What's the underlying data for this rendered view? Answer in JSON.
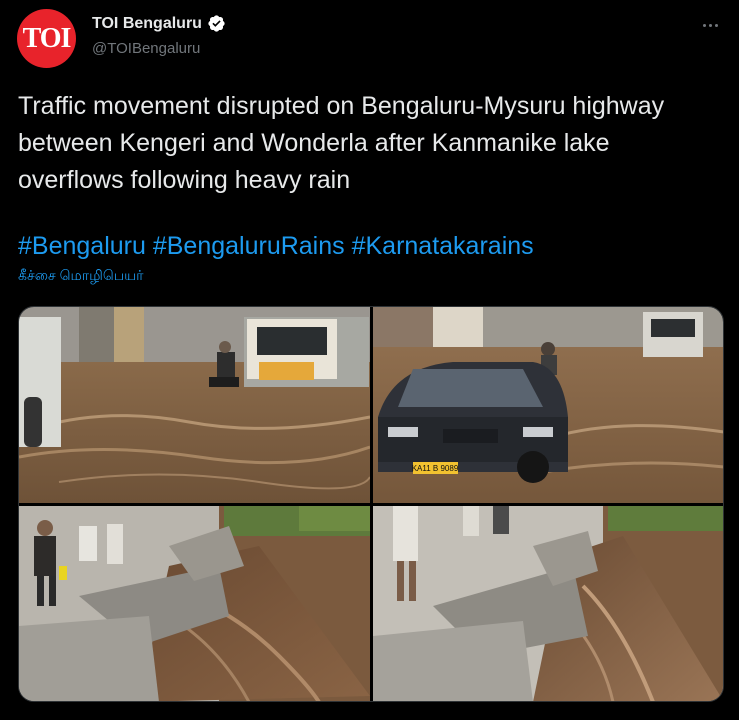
{
  "author": {
    "avatar_text": "TOI",
    "display_name": "TOI Bengaluru",
    "handle": "@TOIBengaluru",
    "verified_icon": "verified-badge-icon"
  },
  "menu": {
    "icon": "more-options-icon"
  },
  "tweet": {
    "text": "Traffic movement disrupted on Bengaluru-Mysuru highway between Kengeri and Wonderla after Kanmanike lake overflows following heavy rain",
    "hashtags": [
      "#Bengaluru",
      "#BengaluruRains",
      "#Karnatakarains"
    ],
    "translate_label": "கீச்சை மொழிபெயர்"
  },
  "media": {
    "photos": [
      {
        "subject": "flooded-highway-truck-photo",
        "plate": ""
      },
      {
        "subject": "car-in-floodwater-photo",
        "plate": "KA11 B 9089"
      },
      {
        "subject": "collapsed-drain-slab-photo",
        "plate": ""
      },
      {
        "subject": "rushing-water-drain-photo",
        "plate": ""
      }
    ]
  },
  "colors": {
    "background": "#000000",
    "text": "#e7e9ea",
    "secondary": "#71767b",
    "accent": "#1d9bf0",
    "avatar": "#e8232b"
  }
}
